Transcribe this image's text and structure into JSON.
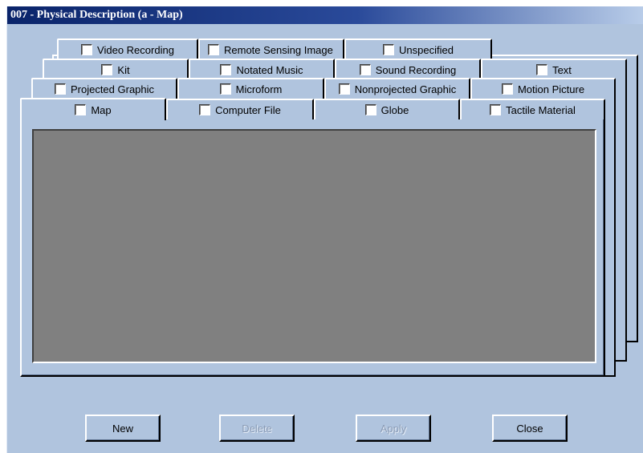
{
  "window": {
    "title": "007 - Physical Description (a - Map)"
  },
  "tabs": {
    "row1": {
      "video_recording": "Video Recording",
      "remote_sensing_image": "Remote Sensing Image",
      "unspecified": "Unspecified"
    },
    "row2": {
      "kit": "Kit",
      "notated_music": "Notated Music",
      "sound_recording": "Sound Recording",
      "text": "Text"
    },
    "row3": {
      "projected_graphic": "Projected Graphic",
      "microform": "Microform",
      "nonprojected_graphic": "Nonprojected Graphic",
      "motion_picture": "Motion Picture"
    },
    "row4": {
      "map": "Map",
      "computer_file": "Computer File",
      "globe": "Globe",
      "tactile_material": "Tactile Material"
    },
    "active": "Map"
  },
  "buttons": {
    "new": "New",
    "delete": "Delete",
    "apply": "Apply",
    "close": "Close",
    "delete_enabled": false,
    "apply_enabled": false
  },
  "colors": {
    "window_bg": "#b0c4de",
    "titlebar_start": "#0a246a",
    "panel_bg": "#808080"
  }
}
